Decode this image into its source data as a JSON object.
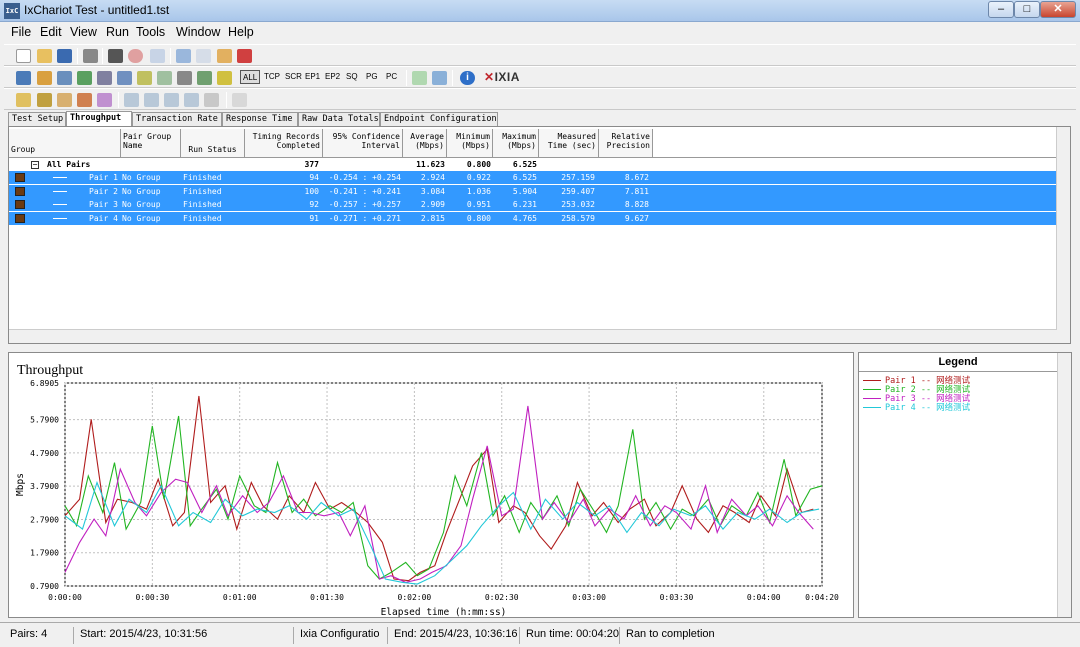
{
  "window": {
    "title": "IxChariot Test - untitled1.tst",
    "app_icon_text": "IxC"
  },
  "menu": [
    "File",
    "Edit",
    "View",
    "Run",
    "Tools",
    "Window",
    "Help"
  ],
  "toolbar2_text_buttons": [
    "ALL",
    "TCP",
    "SCR",
    "EP1",
    "EP2",
    "SQ",
    "PG",
    "PC"
  ],
  "brand": "IXIA",
  "tabs": [
    "Test Setup",
    "Throughput",
    "Transaction Rate",
    "Response Time",
    "Raw Data Totals",
    "Endpoint Configuration"
  ],
  "active_tab": "Throughput",
  "table": {
    "headers": [
      "Group",
      "Pair Group Name",
      "Run Status",
      "Timing Records Completed",
      "95% Confidence Interval",
      "Average (Mbps)",
      "Minimum (Mbps)",
      "Maximum (Mbps)",
      "Measured Time (sec)",
      "Relative Precision"
    ],
    "summary": {
      "label": "All Pairs",
      "records": "377",
      "average": "11.623",
      "minimum": "0.800",
      "maximum": "6.525"
    },
    "rows": [
      {
        "pair": "Pair 1",
        "group": "No Group",
        "status": "Finished",
        "records": "94",
        "ci": "-0.254 : +0.254",
        "avg": "2.924",
        "min": "0.922",
        "max": "6.525",
        "time": "257.159",
        "prec": "8.672"
      },
      {
        "pair": "Pair 2",
        "group": "No Group",
        "status": "Finished",
        "records": "100",
        "ci": "-0.241 : +0.241",
        "avg": "3.084",
        "min": "1.036",
        "max": "5.904",
        "time": "259.407",
        "prec": "7.811"
      },
      {
        "pair": "Pair 3",
        "group": "No Group",
        "status": "Finished",
        "records": "92",
        "ci": "-0.257 : +0.257",
        "avg": "2.909",
        "min": "0.951",
        "max": "6.231",
        "time": "253.032",
        "prec": "8.828"
      },
      {
        "pair": "Pair 4",
        "group": "No Group",
        "status": "Finished",
        "records": "91",
        "ci": "-0.271 : +0.271",
        "avg": "2.815",
        "min": "0.800",
        "max": "4.765",
        "time": "258.579",
        "prec": "9.627"
      }
    ]
  },
  "chart_data": {
    "type": "line",
    "title": "Throughput",
    "xlabel": "Elapsed time (h:mm:ss)",
    "ylabel": "Mbps",
    "ylim": [
      0.7905,
      6.8905
    ],
    "xlim": [
      0,
      260
    ],
    "yticks": [
      "6.8905",
      "5.7900",
      "4.7900",
      "3.7900",
      "2.7900",
      "1.7900",
      "0.7900"
    ],
    "ytick_values": [
      6.8905,
      5.79,
      4.79,
      3.79,
      2.79,
      1.79,
      0.79
    ],
    "xticks": [
      "0:00:00",
      "0:00:30",
      "0:01:00",
      "0:01:30",
      "0:02:00",
      "0:02:30",
      "0:03:00",
      "0:03:30",
      "0:04:00",
      "0:04:20"
    ],
    "xtick_values": [
      0,
      30,
      60,
      90,
      120,
      150,
      180,
      210,
      240,
      260
    ],
    "grid": true,
    "series": [
      {
        "name": "Pair 1 -- 网络测试",
        "color": "#b01c1c",
        "x": [
          0,
          5,
          9,
          14,
          18,
          23,
          28,
          32,
          37,
          41,
          46,
          50,
          55,
          59,
          64,
          68,
          73,
          77,
          82,
          86,
          91,
          95,
          100,
          104,
          109,
          113,
          118,
          122,
          127,
          131,
          136,
          140,
          145,
          149,
          154,
          158,
          163,
          167,
          172,
          176,
          181,
          185,
          190,
          194,
          199,
          203,
          208,
          212,
          217,
          221,
          226,
          230,
          235,
          239,
          244,
          248,
          253,
          257
        ],
        "y": [
          2.9,
          3.4,
          5.8,
          2.7,
          3.4,
          3.3,
          3.1,
          4.0,
          2.6,
          3.0,
          6.5,
          3.3,
          3.8,
          2.5,
          3.9,
          3.2,
          2.8,
          3.5,
          3.0,
          3.9,
          3.1,
          3.3,
          3.0,
          2.7,
          2.1,
          1.0,
          0.95,
          1.2,
          1.4,
          2.4,
          3.5,
          4.4,
          4.9,
          2.7,
          3.2,
          3.0,
          2.3,
          1.9,
          2.6,
          3.9,
          2.9,
          3.3,
          2.7,
          3.1,
          3.4,
          2.6,
          3.0,
          3.8,
          2.8,
          2.4,
          3.2,
          3.0,
          2.7,
          3.5,
          2.9,
          4.3,
          3.0,
          3.1
        ]
      },
      {
        "name": "Pair 2 -- 网络测试",
        "color": "#22b522",
        "x": [
          0,
          4,
          8,
          13,
          17,
          21,
          26,
          30,
          34,
          39,
          43,
          47,
          52,
          56,
          60,
          65,
          69,
          73,
          78,
          82,
          86,
          91,
          95,
          99,
          104,
          108,
          112,
          117,
          121,
          125,
          130,
          134,
          138,
          143,
          147,
          151,
          156,
          160,
          164,
          169,
          173,
          177,
          182,
          186,
          190,
          195,
          199,
          203,
          208,
          212,
          216,
          221,
          225,
          229,
          234,
          238,
          242,
          247,
          251,
          256,
          260
        ],
        "y": [
          3.2,
          2.6,
          4.1,
          3.0,
          4.5,
          2.5,
          3.3,
          5.6,
          3.4,
          5.9,
          2.6,
          3.1,
          3.7,
          2.8,
          4.1,
          3.2,
          3.0,
          4.5,
          3.0,
          3.4,
          2.9,
          3.2,
          3.0,
          3.3,
          1.4,
          1.0,
          1.2,
          1.5,
          1.1,
          1.3,
          2.4,
          4.1,
          3.2,
          4.8,
          2.9,
          3.5,
          2.4,
          3.3,
          2.8,
          3.5,
          2.6,
          3.7,
          3.0,
          2.4,
          3.2,
          5.5,
          2.8,
          3.3,
          2.5,
          3.1,
          2.9,
          3.4,
          2.6,
          3.2,
          2.9,
          3.6,
          2.7,
          4.6,
          2.9,
          3.7,
          3.8
        ]
      },
      {
        "name": "Pair 3 -- 网络测试",
        "color": "#c020c0",
        "x": [
          0,
          5,
          10,
          14,
          19,
          24,
          28,
          33,
          38,
          42,
          47,
          52,
          56,
          61,
          66,
          70,
          75,
          80,
          84,
          89,
          94,
          98,
          103,
          108,
          112,
          117,
          122,
          126,
          131,
          136,
          140,
          145,
          150,
          154,
          159,
          164,
          168,
          173,
          178,
          182,
          187,
          192,
          196,
          201,
          206,
          210,
          215,
          220,
          224,
          229,
          234,
          238,
          243,
          248,
          252,
          257
        ],
        "y": [
          1.2,
          2.1,
          2.8,
          2.3,
          4.3,
          3.3,
          2.9,
          3.6,
          4.0,
          3.9,
          3.0,
          3.8,
          2.9,
          3.5,
          3.0,
          3.3,
          4.1,
          3.0,
          3.0,
          2.9,
          3.0,
          2.3,
          3.2,
          1.0,
          1.1,
          0.9,
          1.0,
          1.2,
          1.4,
          2.0,
          3.4,
          5.0,
          2.9,
          3.1,
          6.2,
          2.8,
          3.3,
          2.7,
          3.4,
          2.6,
          3.1,
          2.8,
          3.5,
          2.6,
          3.2,
          3.0,
          2.5,
          3.8,
          2.4,
          3.4,
          2.9,
          3.2,
          2.6,
          3.5,
          3.0,
          2.5
        ]
      },
      {
        "name": "Pair 4 -- 网络测试",
        "color": "#22c8d8",
        "x": [
          0,
          6,
          11,
          17,
          22,
          28,
          33,
          39,
          44,
          50,
          55,
          61,
          66,
          72,
          77,
          83,
          88,
          94,
          99,
          105,
          110,
          116,
          121,
          127,
          132,
          138,
          143,
          149,
          154,
          160,
          165,
          171,
          176,
          182,
          187,
          193,
          198,
          204,
          209,
          215,
          220,
          226,
          231,
          237,
          242,
          248,
          253,
          259
        ],
        "y": [
          2.9,
          2.5,
          3.9,
          2.6,
          3.4,
          3.0,
          3.8,
          2.6,
          3.0,
          2.7,
          3.4,
          2.9,
          3.1,
          3.0,
          3.2,
          2.8,
          3.3,
          2.9,
          3.1,
          2.0,
          1.0,
          0.9,
          0.85,
          1.1,
          1.5,
          2.0,
          2.6,
          3.2,
          3.6,
          2.5,
          3.4,
          2.8,
          3.3,
          2.9,
          3.2,
          2.4,
          3.0,
          2.6,
          3.1,
          2.9,
          3.2,
          2.5,
          3.0,
          2.8,
          3.1,
          2.7,
          3.0,
          3.1
        ]
      }
    ]
  },
  "legend": {
    "title": "Legend"
  },
  "status": {
    "pairs": "Pairs: 4",
    "start": "Start: 2015/4/23, 10:31:56",
    "config": "Ixia Configuratio",
    "end": "End: 2015/4/23, 10:36:16",
    "runtime": "Run time: 00:04:20",
    "state": "Ran to completion"
  },
  "colors": {
    "selection": "#3399ff",
    "title_bar": "#b9d1ee",
    "ixia_red": "#c0272d"
  }
}
